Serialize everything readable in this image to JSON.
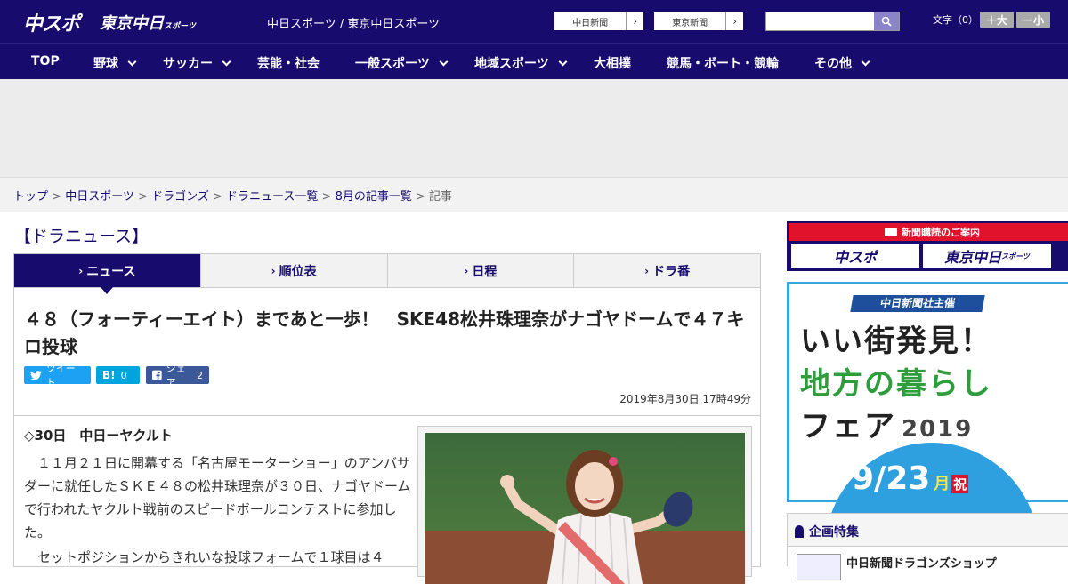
{
  "header": {
    "logo_chuspo": "中スポ",
    "logo_tokyo": "東京中日",
    "logo_tokyo_small": "スポーツ",
    "site_links": "中日スポーツ / 東京中日スポーツ",
    "btn_chunichi": "中日新聞",
    "btn_tokyo": "東京新聞",
    "search_placeholder": "",
    "font_label": "文字（0）",
    "font_plus": "＋大",
    "font_minus": "－小"
  },
  "nav": {
    "items": [
      "TOP",
      "野球",
      "サッカー",
      "芸能・社会",
      "一般スポーツ",
      "地域スポーツ",
      "大相撲",
      "競馬・ボート・競輪",
      "その他"
    ]
  },
  "breadcrumb": {
    "items": [
      "トップ",
      "中日スポーツ",
      "ドラゴンズ",
      "ドラニュース一覧",
      "8月の記事一覧",
      "記事"
    ],
    "sep": " > "
  },
  "section_title": "【ドラニュース】",
  "tabs": [
    "ニュース",
    "順位表",
    "日程",
    "ドラ番"
  ],
  "article": {
    "title": "４８（フォーティーエイト）まであと一歩！　SKE48松井珠理奈がナゴヤドームで４７キロ投球",
    "share_tweet": "ツイート",
    "share_hatena": "B!",
    "share_hatena_count": "0",
    "share_fb": "シェア",
    "share_fb_count": "2",
    "date": "2019年8月30日 17時49分",
    "lead": "◇30日　中日ーヤクルト",
    "para1": "　１１月２１日に開幕する「名古屋モーターショー」のアンバサダーに就任したＳＫＥ４８の松井珠理奈が３０日、ナゴヤドームで行われたヤクルト戦前のスピードボールコンテストに参加した。",
    "para2": "　セットポジションからきれいな投球フォームで１球目は４"
  },
  "sidebar": {
    "sub_title": "新聞購読のご案内",
    "sub_btn1": "中スポ",
    "sub_btn2": "東京中日",
    "sub_btn2_small": "スポーツ",
    "banner_tag": "中日新聞社主催",
    "banner_line1": "いい街発見！",
    "banner_line2": "地方の暮らし",
    "banner_line3": "フェア",
    "banner_year": "2019",
    "banner_date": "9/23",
    "banner_day": "月",
    "banner_holiday": "祝",
    "feature_title": "企画特集",
    "feature_item": "中日新聞ドラゴンズショップ"
  },
  "colors": {
    "brand_navy": "#170c6e",
    "accent_red": "#e0122c",
    "accent_blue": "#3aa6e0",
    "twitter": "#1da1f2",
    "hatena": "#00a4de",
    "facebook": "#3b5998"
  }
}
